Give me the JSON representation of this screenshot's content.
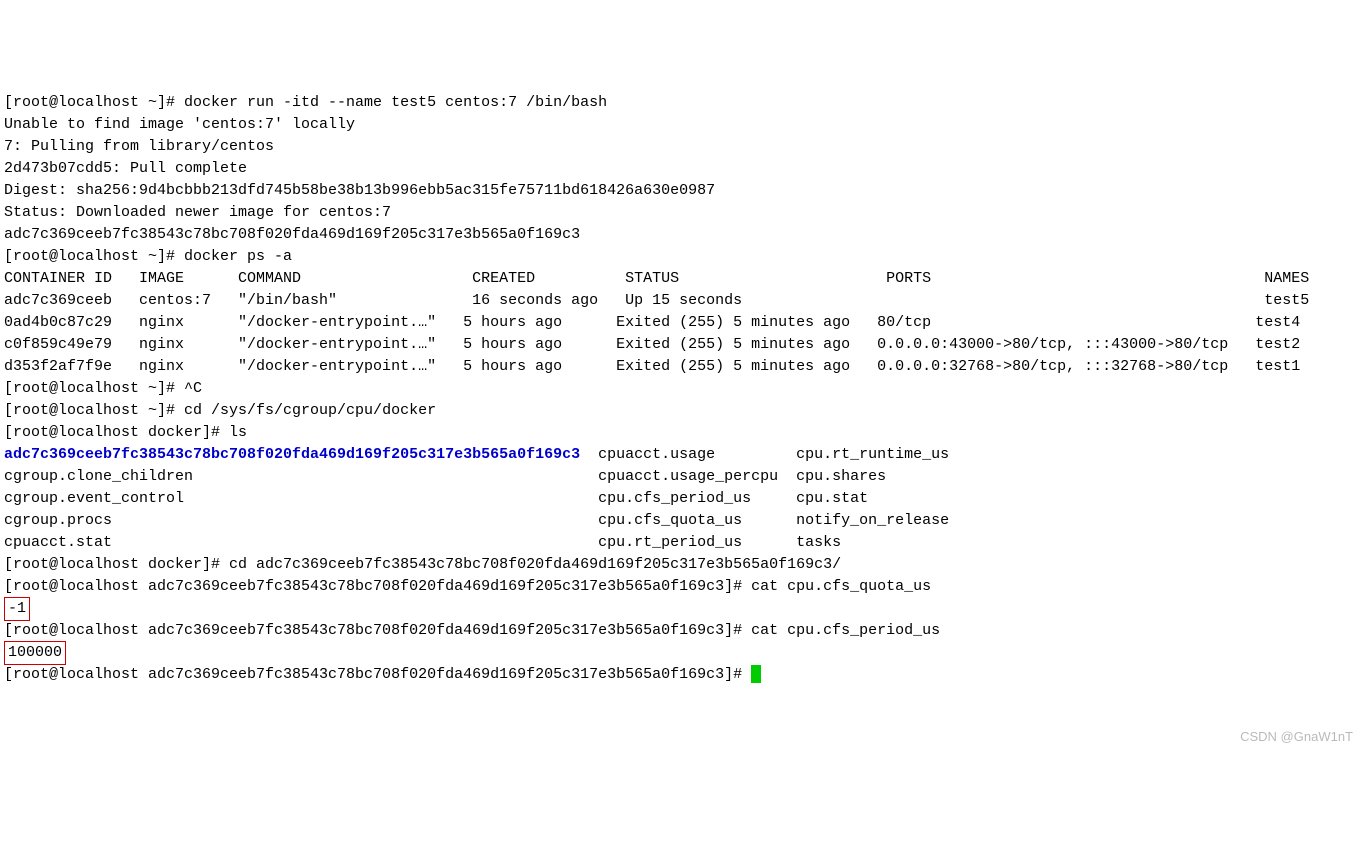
{
  "prompt1": "[root@localhost ~]# ",
  "cmd1": "docker run -itd --name test5 centos:7 /bin/bash",
  "out1_l1": "Unable to find image 'centos:7' locally",
  "out1_l2": "7: Pulling from library/centos",
  "out1_l3": "2d473b07cdd5: Pull complete",
  "out1_l4": "Digest: sha256:9d4bcbbb213dfd745b58be38b13b996ebb5ac315fe75711bd618426a630e0987",
  "out1_l5": "Status: Downloaded newer image for centos:7",
  "out1_l6": "adc7c369ceeb7fc38543c78bc708f020fda469d169f205c317e3b565a0f169c3",
  "prompt2": "[root@localhost ~]# ",
  "cmd2": "docker ps -a",
  "ps_header": "CONTAINER ID   IMAGE      COMMAND                   CREATED          STATUS                       PORTS                                     NAMES",
  "ps_r1": "adc7c369ceeb   centos:7   \"/bin/bash\"               16 seconds ago   Up 15 seconds                                                          test5",
  "ps_r2": "0ad4b0c87c29   nginx      \"/docker-entrypoint.…\"   5 hours ago      Exited (255) 5 minutes ago   80/tcp                                    test4",
  "ps_r3": "c0f859c49e79   nginx      \"/docker-entrypoint.…\"   5 hours ago      Exited (255) 5 minutes ago   0.0.0.0:43000->80/tcp, :::43000->80/tcp   test2",
  "ps_r4": "d353f2af7f9e   nginx      \"/docker-entrypoint.…\"   5 hours ago      Exited (255) 5 minutes ago   0.0.0.0:32768->80/tcp, :::32768->80/tcp   test1",
  "prompt3": "[root@localhost ~]# ",
  "cmd3": "^C",
  "prompt4": "[root@localhost ~]# ",
  "cmd4": "cd /sys/fs/cgroup/cpu/docker",
  "prompt5": "[root@localhost docker]# ",
  "cmd5": "ls",
  "ls_dir": "adc7c369ceeb7fc38543c78bc708f020fda469d169f205c317e3b565a0f169c3",
  "ls_c1": "  cpuacct.usage         cpu.rt_runtime_us",
  "ls_r2": "cgroup.clone_children                                             cpuacct.usage_percpu  cpu.shares",
  "ls_r3": "cgroup.event_control                                              cpu.cfs_period_us     cpu.stat",
  "ls_r4": "cgroup.procs                                                      cpu.cfs_quota_us      notify_on_release",
  "ls_r5": "cpuacct.stat                                                      cpu.rt_period_us      tasks",
  "prompt6": "[root@localhost docker]# ",
  "cmd6": "cd adc7c369ceeb7fc38543c78bc708f020fda469d169f205c317e3b565a0f169c3/",
  "prompt7": "[root@localhost adc7c369ceeb7fc38543c78bc708f020fda469d169f205c317e3b565a0f169c3]# ",
  "cmd7": "cat cpu.cfs_quota_us",
  "out7": "-1",
  "prompt8": "[root@localhost adc7c369ceeb7fc38543c78bc708f020fda469d169f205c317e3b565a0f169c3]# ",
  "cmd8": "cat cpu.cfs_period_us",
  "out8": "100000",
  "prompt9": "[root@localhost adc7c369ceeb7fc38543c78bc708f020fda469d169f205c317e3b565a0f169c3]# ",
  "watermark": "CSDN @GnaW1nT"
}
